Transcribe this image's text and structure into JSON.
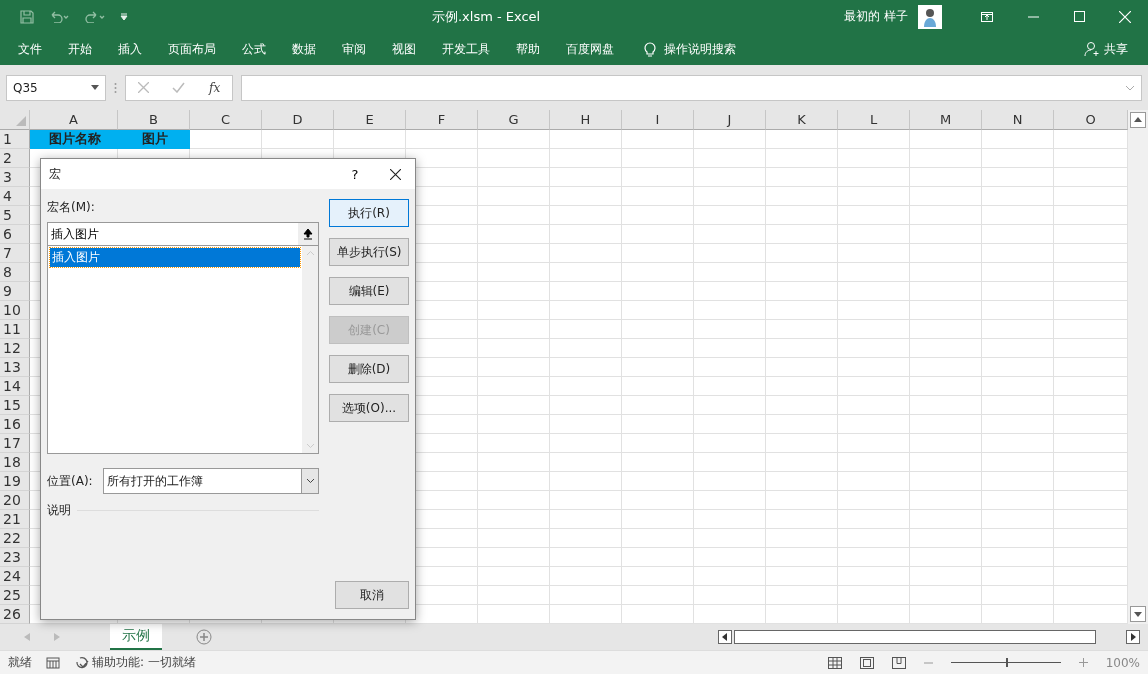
{
  "window": {
    "title": "示例.xlsm  -  Excel",
    "user": "最初的 样子"
  },
  "ribbon": {
    "tabs": [
      "文件",
      "开始",
      "插入",
      "页面布局",
      "公式",
      "数据",
      "审阅",
      "视图",
      "开发工具",
      "帮助",
      "百度网盘"
    ],
    "search": "操作说明搜索",
    "share": "共享"
  },
  "formula_bar": {
    "name_box": "Q35",
    "fx": "fx"
  },
  "sheet": {
    "columns": [
      "A",
      "B",
      "C",
      "D",
      "E",
      "F",
      "G",
      "H",
      "I",
      "J",
      "K",
      "L",
      "M",
      "N",
      "O"
    ],
    "rows": [
      {
        "number": "1",
        "cells": [
          {
            "text": "图片名称",
            "color": "#00b0f0"
          },
          {
            "text": "图片",
            "color": "#00b0f0"
          }
        ]
      },
      {
        "number": "2",
        "cells": []
      },
      {
        "number": "3",
        "cells": []
      },
      {
        "number": "4",
        "cells": []
      },
      {
        "number": "5",
        "cells": []
      },
      {
        "number": "6",
        "cells": []
      },
      {
        "number": "7",
        "cells": []
      },
      {
        "number": "8",
        "cells": []
      },
      {
        "number": "9",
        "cells": []
      },
      {
        "number": "10",
        "cells": []
      },
      {
        "number": "11",
        "cells": []
      },
      {
        "number": "12",
        "cells": []
      },
      {
        "number": "13",
        "cells": []
      },
      {
        "number": "14",
        "cells": []
      },
      {
        "number": "15",
        "cells": []
      },
      {
        "number": "16",
        "cells": []
      },
      {
        "number": "17",
        "cells": []
      },
      {
        "number": "18",
        "cells": []
      },
      {
        "number": "19",
        "cells": []
      },
      {
        "number": "20",
        "cells": []
      },
      {
        "number": "21",
        "cells": []
      },
      {
        "number": "22",
        "cells": []
      },
      {
        "number": "23",
        "cells": []
      },
      {
        "number": "24",
        "cells": []
      },
      {
        "number": "25",
        "cells": []
      },
      {
        "number": "26",
        "cells": []
      }
    ]
  },
  "dialog": {
    "title": "宏",
    "help": "?",
    "macro_name_label": "宏名(M):",
    "macro_name": "插入图片",
    "macros": [
      {
        "label": "插入图片",
        "selected": true
      }
    ],
    "buttons": [
      {
        "label": "执行(R)",
        "disabled": false,
        "default": true
      },
      {
        "label": "单步执行(S)",
        "disabled": false,
        "default": false
      },
      {
        "label": "编辑(E)",
        "disabled": false,
        "default": false
      },
      {
        "label": "创建(C)",
        "disabled": true,
        "default": false
      },
      {
        "label": "删除(D)",
        "disabled": false,
        "default": false
      },
      {
        "label": "选项(O)...",
        "disabled": false,
        "default": false
      }
    ],
    "location_label": "位置(A):",
    "location": "所有打开的工作簿",
    "description_label": "说明",
    "cancel": "取消"
  },
  "sheet_tabs": [
    {
      "label": "示例",
      "selected": true
    }
  ],
  "status_bar": {
    "ready": "就绪",
    "accessibility": "辅助功能: 一切就绪",
    "zoom_slider": {
      "level": 0.5
    },
    "zoom": "100%"
  }
}
